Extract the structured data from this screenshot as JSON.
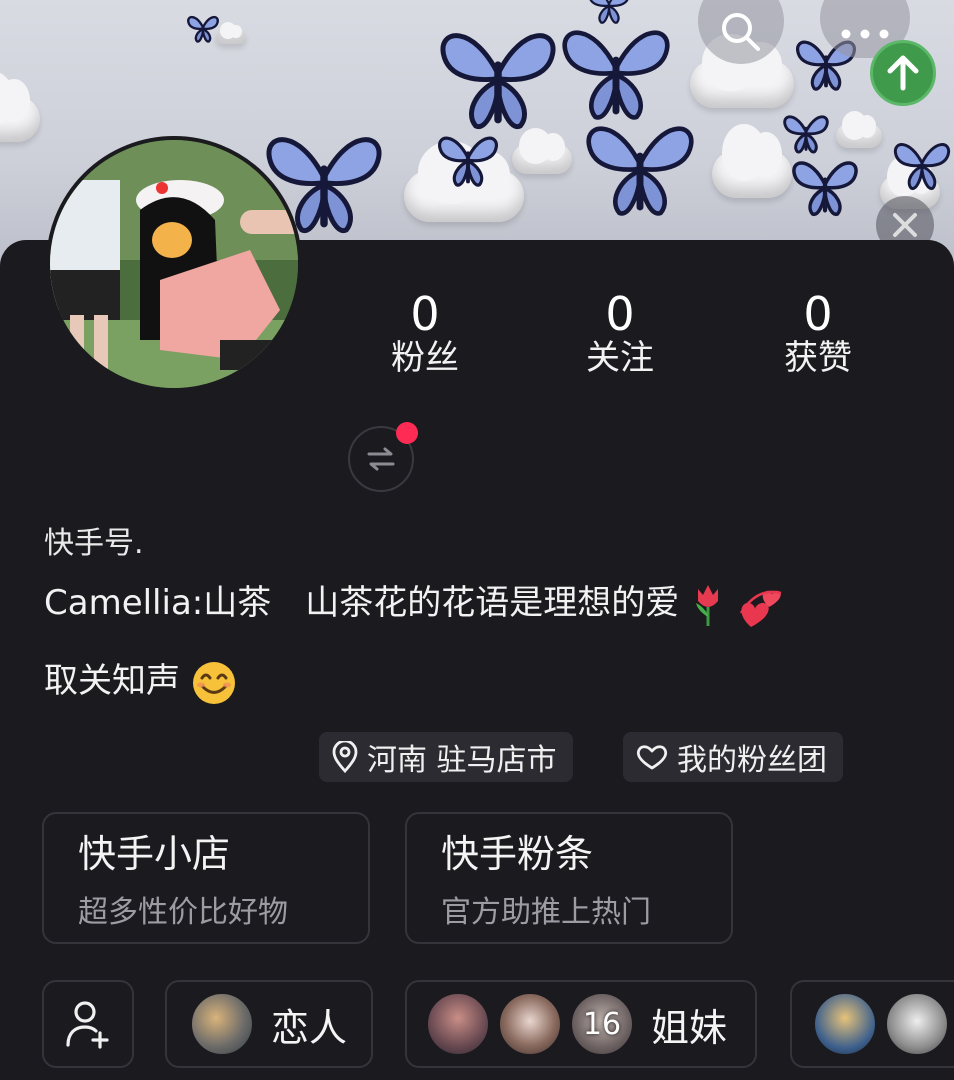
{
  "profile": {
    "stats": [
      {
        "value": "0",
        "label": "粉丝"
      },
      {
        "value": "0",
        "label": "关注"
      },
      {
        "value": "0",
        "label": "获赞"
      }
    ],
    "kuaishou_id_label": "快手号.",
    "bio_line1": "Camellia:山茶　山茶花的花语是理想的爱",
    "bio_line2": "取关知声"
  },
  "tags": {
    "location": "河南 驻马店市",
    "fan_group": "我的粉丝团"
  },
  "cards": [
    {
      "title": "快手小店",
      "subtitle": "超多性价比好物"
    },
    {
      "title": "快手粉条",
      "subtitle": "官方助推上热门"
    }
  ],
  "relations": {
    "lovers": "恋人",
    "sisters": "姐妹",
    "sisters_count": "16"
  },
  "icons": {
    "search": "search-icon",
    "more": "more-icon",
    "upload": "arrow-up-icon",
    "close": "close-icon",
    "switch": "switch-account-icon",
    "location": "location-pin-icon",
    "fan_group": "heart-outline-icon",
    "add_friend": "add-user-icon"
  },
  "colors": {
    "background": "#1b1a1f",
    "notification_dot": "#fe2c55",
    "upload_button": "#3f9b4b",
    "secondary_text": "#9d9ca3"
  }
}
